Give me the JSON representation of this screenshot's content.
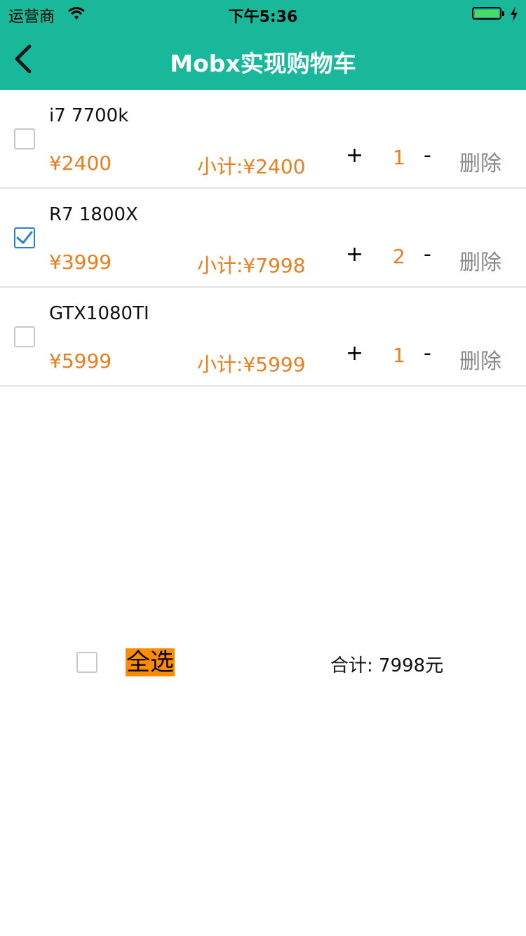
{
  "status_bar": {
    "carrier": "运营商",
    "time": "下午5:36"
  },
  "nav": {
    "title": "Mobx实现购物车"
  },
  "items": [
    {
      "name": "i7 7700k",
      "price": "¥2400",
      "subtotal": "小计:¥2400",
      "plus": "+",
      "quantity": "1",
      "minus": "-",
      "delete": "删除",
      "checked": false
    },
    {
      "name": "R7 1800X",
      "price": "¥3999",
      "subtotal": "小计:¥7998",
      "plus": "+",
      "quantity": "2",
      "minus": "-",
      "delete": "删除",
      "checked": true
    },
    {
      "name": "GTX1080TI",
      "price": "¥5999",
      "subtotal": "小计:¥5999",
      "plus": "+",
      "quantity": "1",
      "minus": "-",
      "delete": "删除",
      "checked": false
    }
  ],
  "footer": {
    "select_all": "全选",
    "total": "合计: 7998元"
  },
  "colors": {
    "header": "#1ab89a",
    "price": "#e67e22",
    "select_all_bg": "#ff8c00",
    "checkbox_checked": "#2a7fd4"
  },
  "icons": [
    "wifi-icon",
    "battery-icon",
    "charging-icon",
    "back-chevron-icon",
    "checkmark-icon"
  ]
}
